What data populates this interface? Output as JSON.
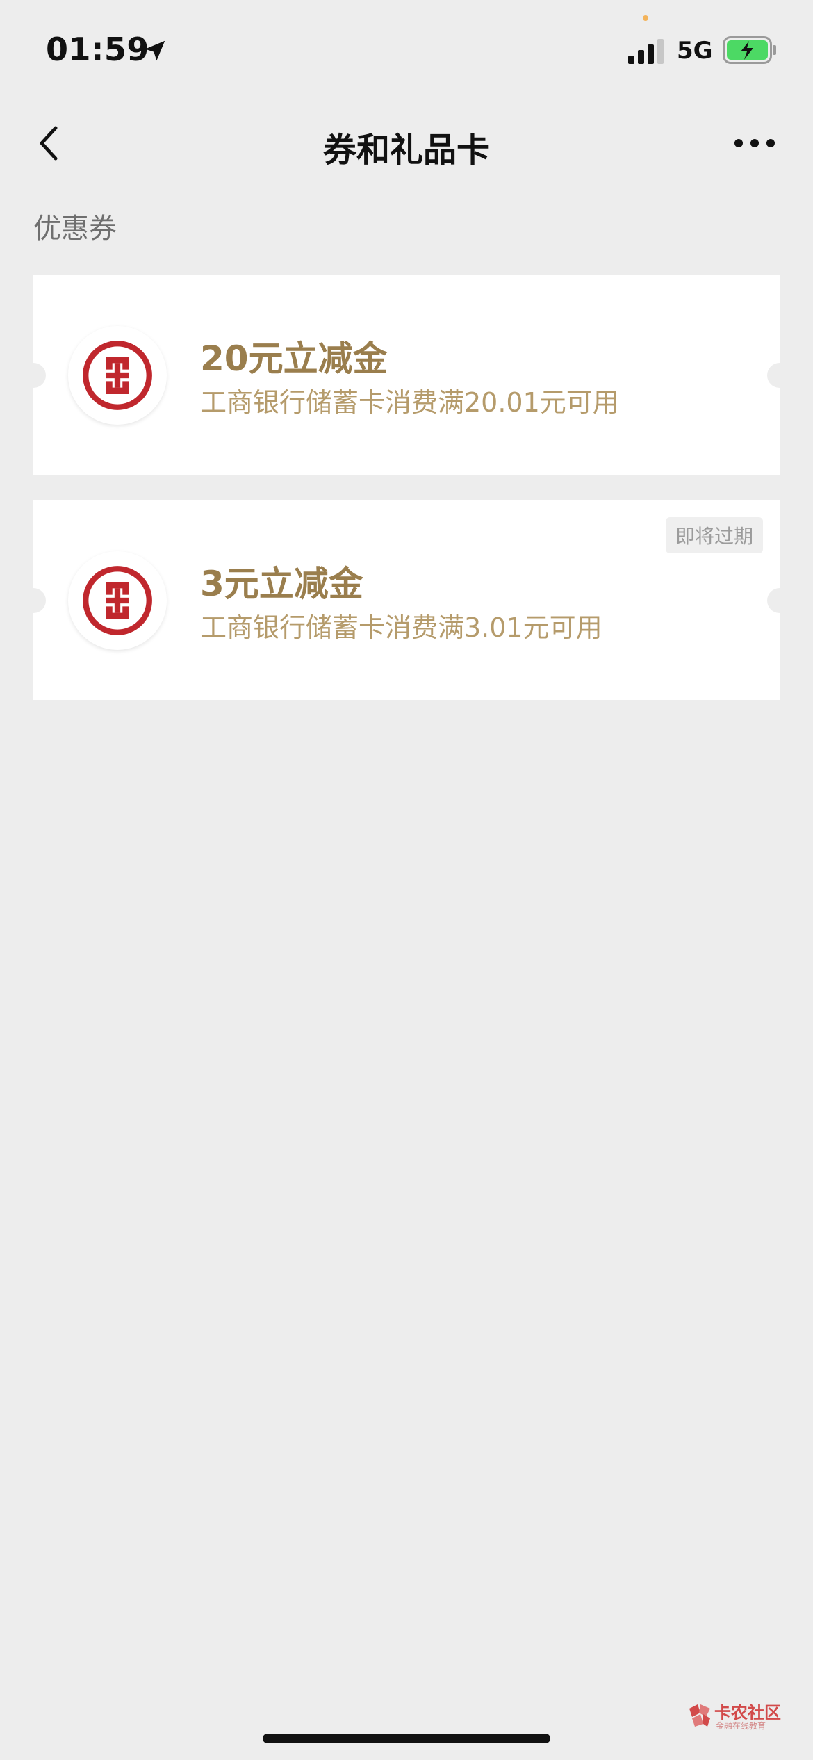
{
  "status_bar": {
    "time": "01:59",
    "network": "5G",
    "icons": {
      "location": "location-arrow-icon",
      "signal": "cellular-signal-icon",
      "battery": "battery-charging-icon"
    },
    "battery_color": "#4cd964"
  },
  "nav": {
    "title": "券和礼品卡",
    "back_icon": "chevron-left-icon",
    "more_icon": "more-horizontal-icon"
  },
  "section": {
    "title": "优惠券"
  },
  "coupons": [
    {
      "title": "20元立减金",
      "description": "工商银行储蓄卡消费满20.01元可用",
      "badge": "",
      "logo_icon": "icbc-logo-icon"
    },
    {
      "title": "3元立减金",
      "description": "工商银行储蓄卡消费满3.01元可用",
      "badge": "即将过期",
      "logo_icon": "icbc-logo-icon"
    }
  ],
  "watermark": {
    "text": "卡农社区",
    "subtext": "金融在线教育"
  },
  "colors": {
    "background": "#ededed",
    "card": "#ffffff",
    "coupon_title": "#9a7e4d",
    "coupon_desc": "#b59b6b",
    "icbc_red": "#c0272d"
  }
}
